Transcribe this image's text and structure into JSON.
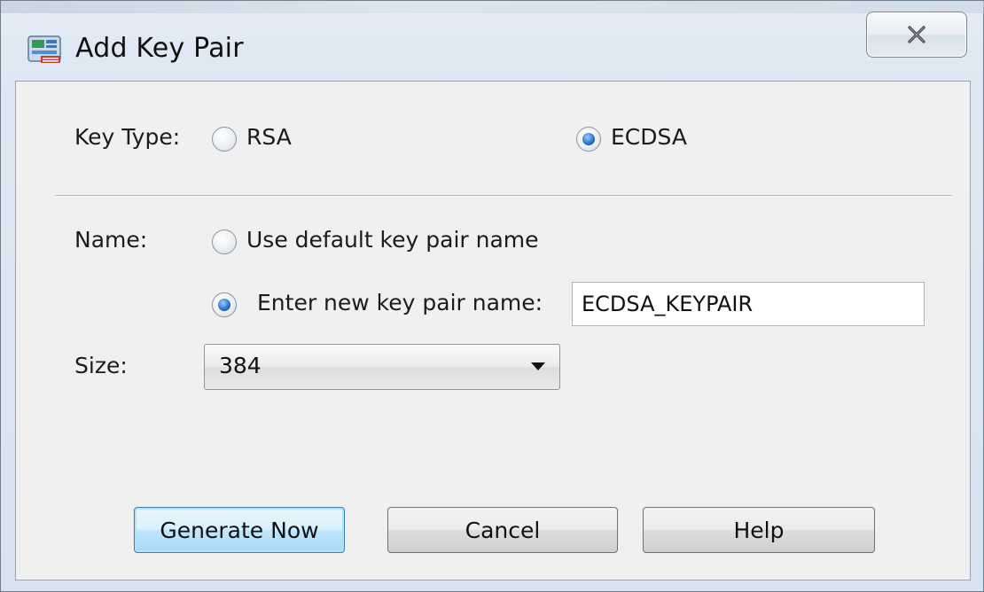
{
  "window": {
    "title": "Add Key Pair",
    "title_icon": "key-pair-app-icon",
    "close_icon": "close-icon"
  },
  "key_type": {
    "label": "Key Type:",
    "options": [
      {
        "label": "RSA",
        "checked": false
      },
      {
        "label": "ECDSA",
        "checked": true
      }
    ]
  },
  "name": {
    "label": "Name:",
    "options": [
      {
        "label": "Use default key pair name",
        "checked": false
      },
      {
        "label": "Enter new key pair name:",
        "checked": true
      }
    ],
    "new_name_value": "ECDSA_KEYPAIR"
  },
  "size": {
    "label": "Size:",
    "selected": "384"
  },
  "buttons": {
    "generate": "Generate Now",
    "cancel": "Cancel",
    "help": "Help"
  }
}
